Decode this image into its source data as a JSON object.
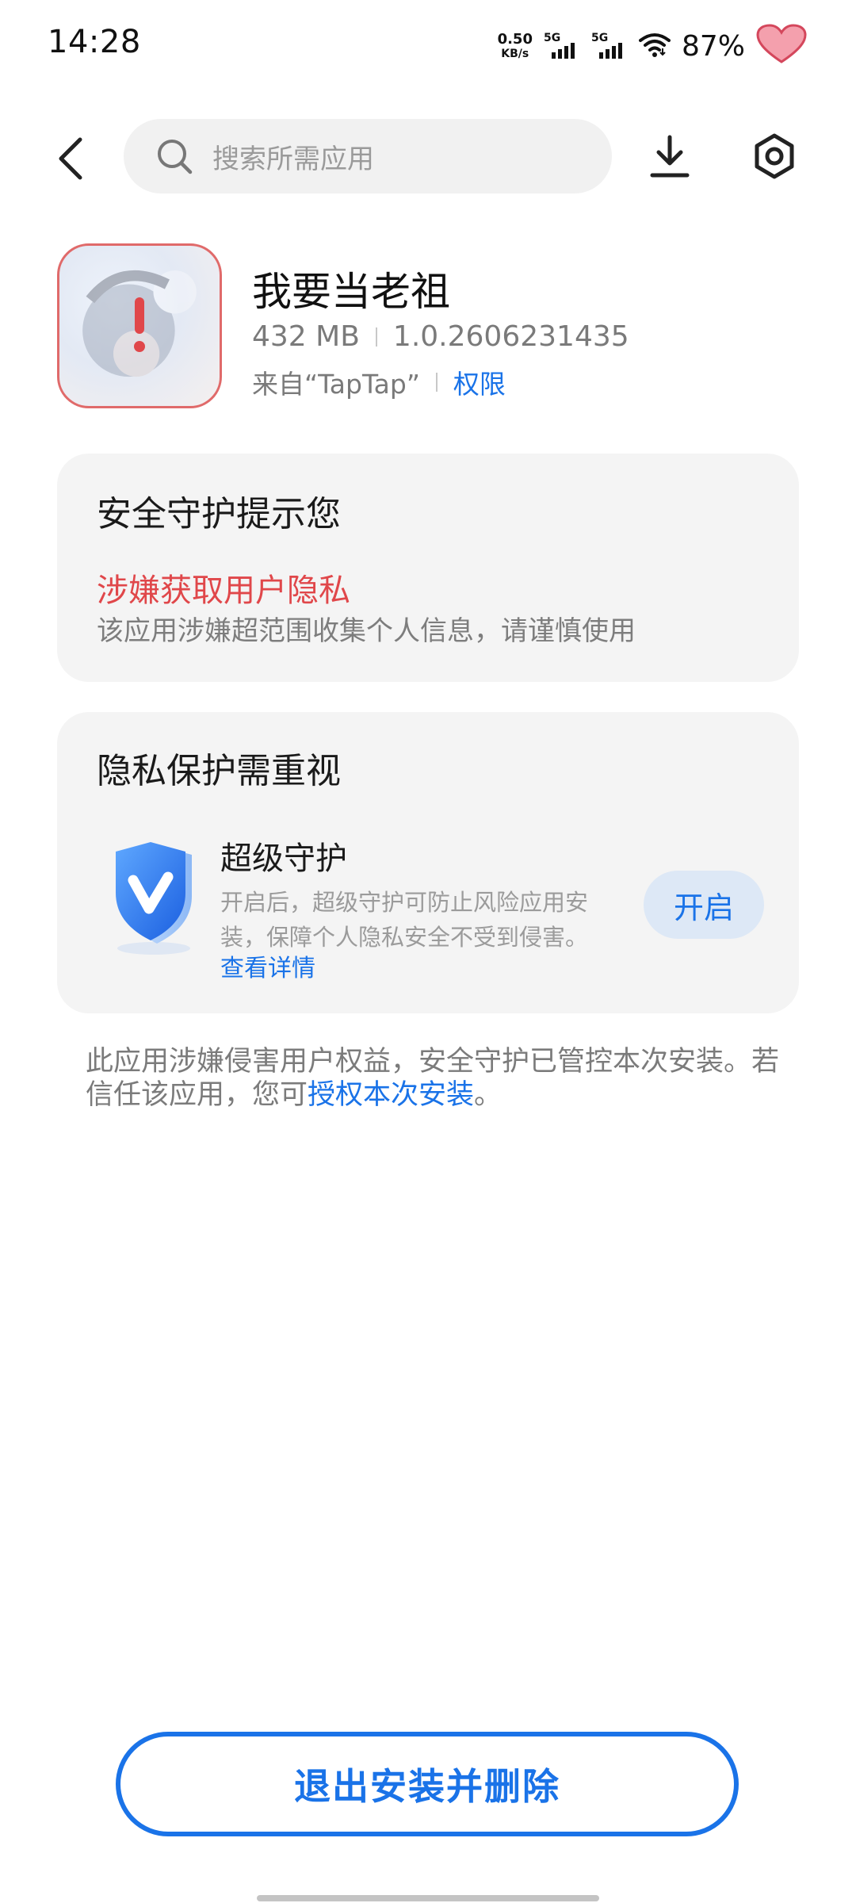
{
  "status_bar": {
    "time": "14:28",
    "net_speed_value": "0.50",
    "net_speed_unit": "KB/s",
    "sim1_tag": "5G",
    "sim2_tag": "5G",
    "battery": "87%",
    "icons": [
      "wifi-icon",
      "heart-battery-icon",
      "signal-icon"
    ]
  },
  "header": {
    "search_placeholder": "搜索所需应用",
    "icons": [
      "back-arrow-icon",
      "search-icon",
      "download-icon",
      "settings-icon"
    ]
  },
  "app": {
    "name": "我要当老祖",
    "size": "432 MB",
    "version": "1.0.2606231435",
    "source": "来自“TapTap”",
    "permissions_link": "权限",
    "icon_status": "warning-icon"
  },
  "security_card": {
    "title": "安全守护提示您",
    "risk_title": "涉嫌获取用户隐私",
    "risk_desc": "该应用涉嫌超范围收集个人信息，请谨慎使用"
  },
  "privacy_card": {
    "title": "隐私保护需重视",
    "feature_title": "超级守护",
    "feature_desc": "开启后，超级守护可防止风险应用安装，保障个人隐私安全不受到侵害。",
    "details_link": "查看详情",
    "enable_label": "开启",
    "feature_icon": "shield-v-icon"
  },
  "notice": {
    "text_part1": "此应用涉嫌侵害用户权益，安全守护已管控本次安装。若信任该应用，您可",
    "link": "授权本次安装",
    "text_part2": "。"
  },
  "footer": {
    "exit_label": "退出安装并删除"
  },
  "colors": {
    "accent_blue": "#1a73e8",
    "risk_red": "#e0474a",
    "card_bg": "#f4f4f4"
  }
}
